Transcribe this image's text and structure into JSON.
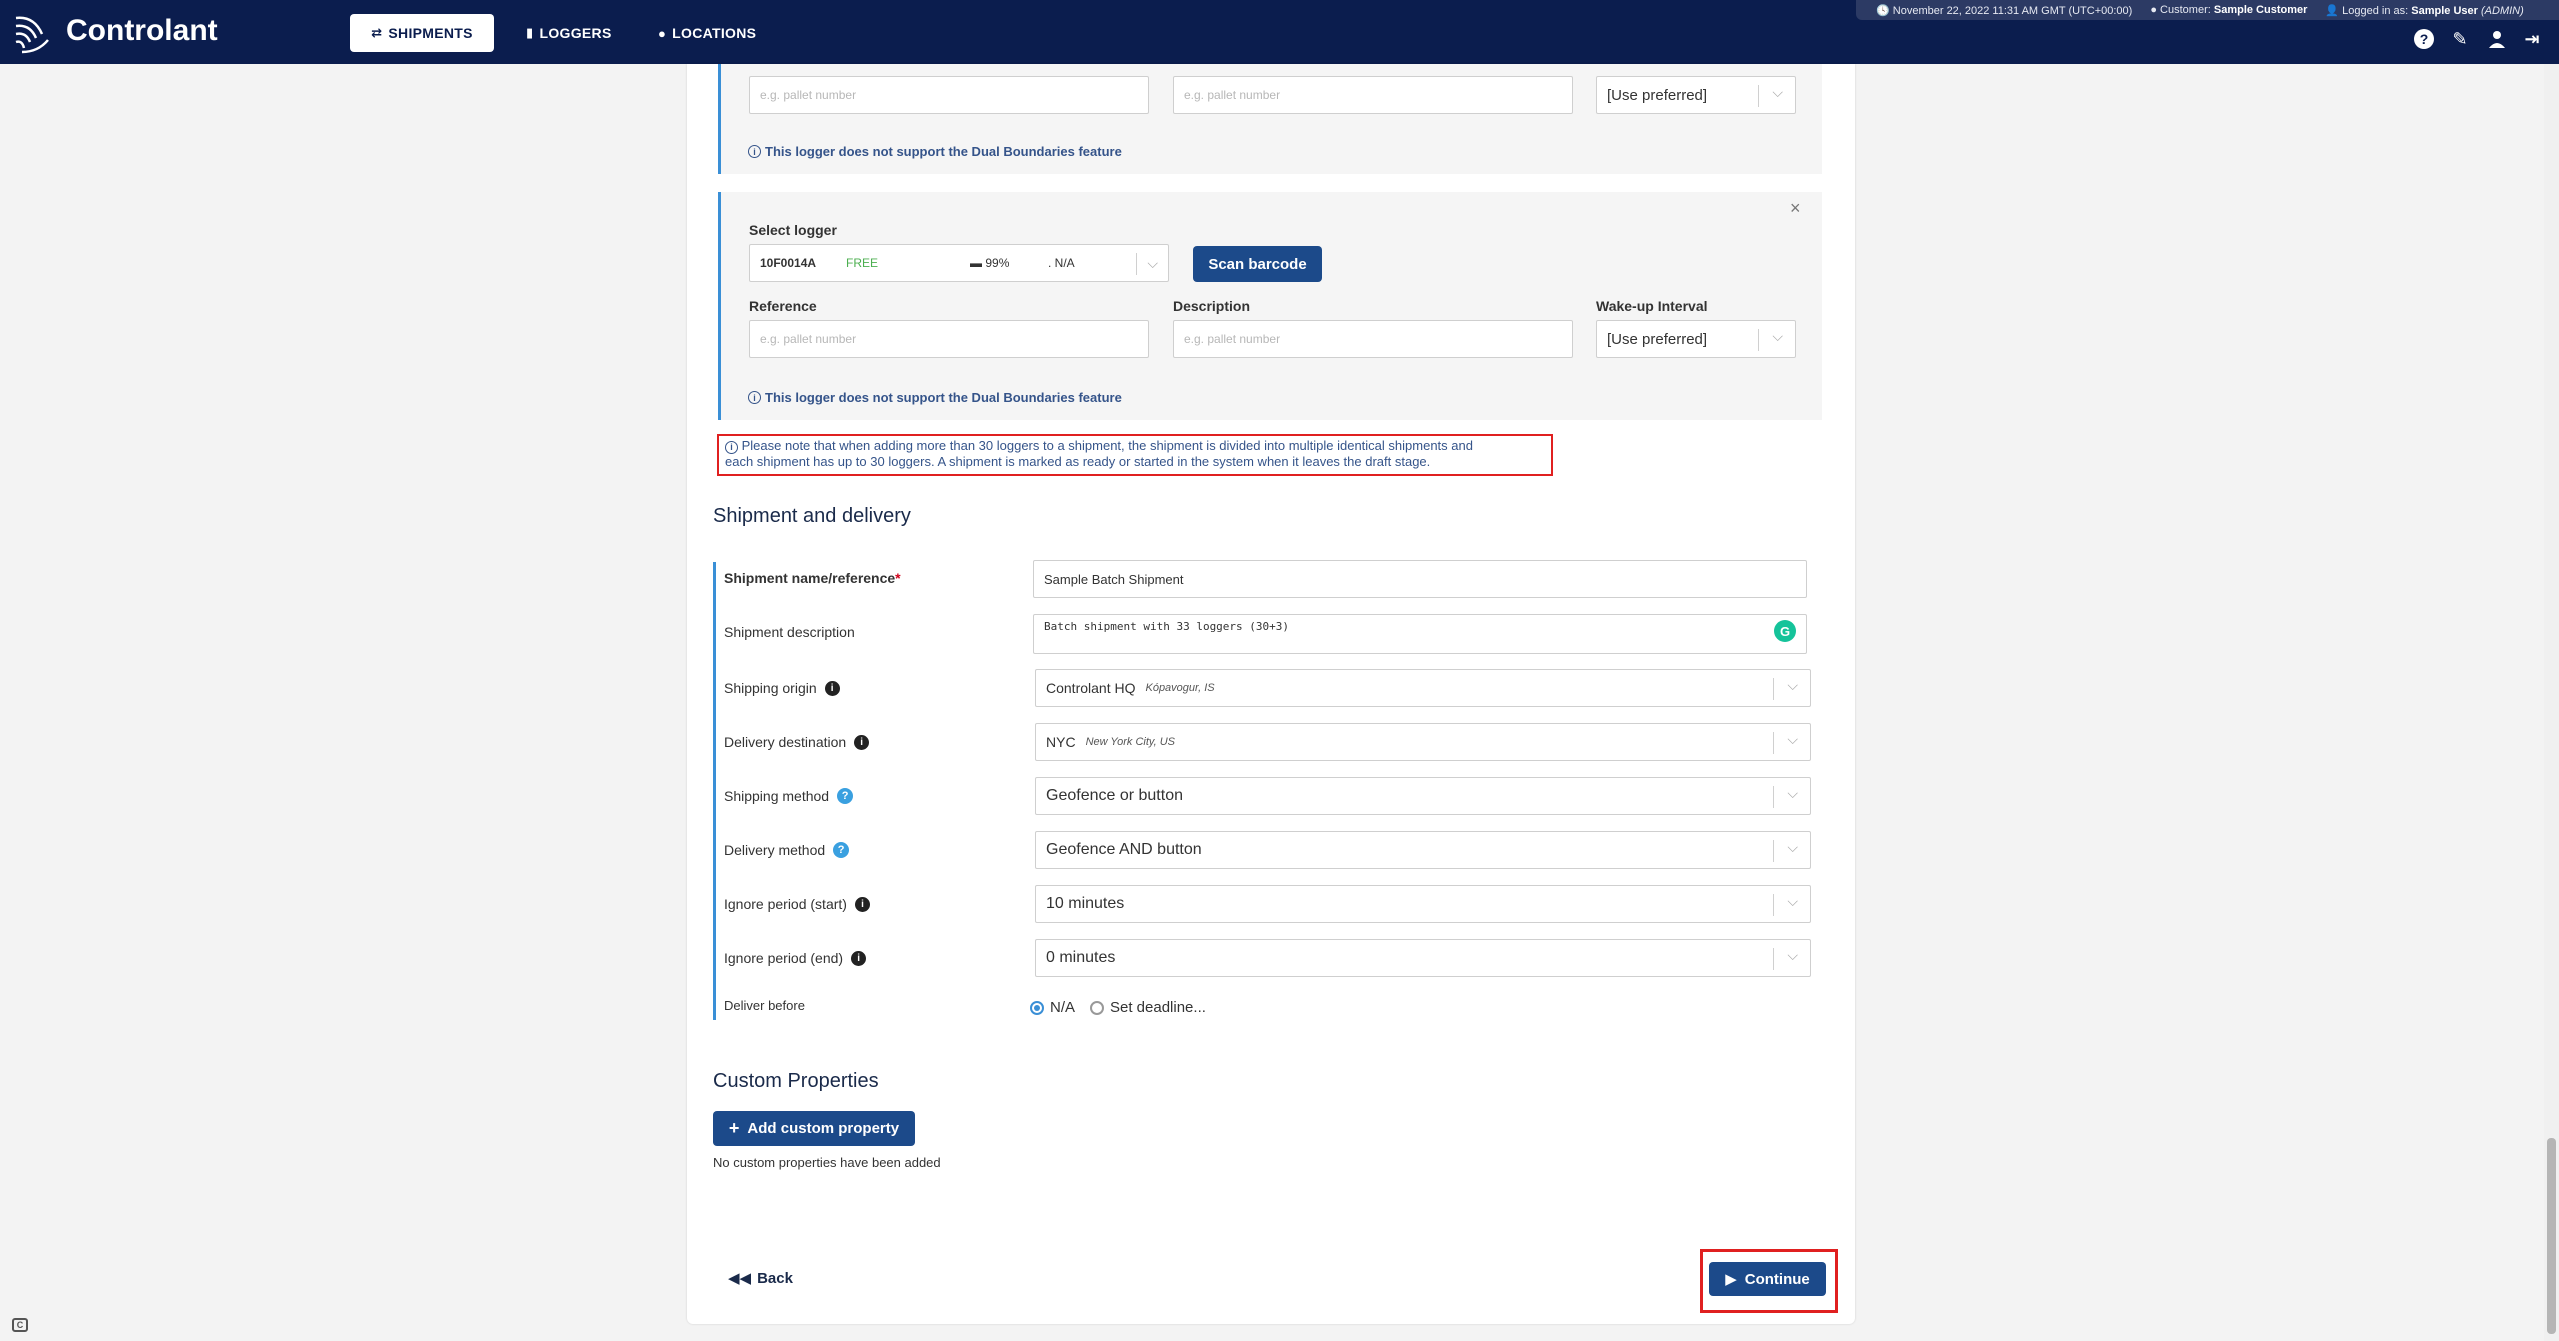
{
  "app": {
    "brand": "Controlant"
  },
  "nav": {
    "shipments": "SHIPMENTS",
    "loggers": "LOGGERS",
    "locations": "LOCATIONS"
  },
  "infobar": {
    "datetime": "November 22, 2022 11:31 AM GMT (UTC+00:00)",
    "customer_label": "Customer:",
    "customer_value": "Sample Customer",
    "logged_label": "Logged in as:",
    "logged_value": "Sample User",
    "role": "(ADMIN)"
  },
  "logger1": {
    "reference_placeholder": "e.g. pallet number",
    "description_placeholder": "e.g. pallet number",
    "wakeup_value": "[Use preferred]",
    "note": "This logger does not support the Dual Boundaries feature"
  },
  "logger2": {
    "select_logger_label": "Select logger",
    "logger_id": "10F0014A",
    "logger_status": "FREE",
    "logger_battery": "99%",
    "logger_signal": "N/A",
    "scan_barcode": "Scan barcode",
    "reference_label": "Reference",
    "description_label": "Description",
    "wakeup_label": "Wake-up Interval",
    "reference_placeholder": "e.g. pallet number",
    "description_placeholder": "e.g. pallet number",
    "wakeup_value": "[Use preferred]",
    "note": "This logger does not support the Dual Boundaries feature"
  },
  "warning": {
    "line1": "Please note that when adding more than 30 loggers to a shipment, the shipment is divided into multiple identical shipments and",
    "line2": "each shipment has up to 30 loggers. A shipment is marked as ready or started in the system when it leaves the draft stage."
  },
  "shipment": {
    "section_title": "Shipment and delivery",
    "name_label": "Shipment name/reference",
    "name_value": "Sample Batch Shipment",
    "description_label": "Shipment description",
    "description_value": "Batch shipment with 33 loggers (30+3)",
    "origin_label": "Shipping origin",
    "origin_value": "Controlant HQ",
    "origin_sub": "Kópavogur, IS",
    "destination_label": "Delivery destination",
    "destination_value": "NYC",
    "destination_sub": "New York City, US",
    "shipping_method_label": "Shipping method",
    "shipping_method_value": "Geofence or button",
    "delivery_method_label": "Delivery method",
    "delivery_method_value": "Geofence AND button",
    "ignore_start_label": "Ignore period (start)",
    "ignore_start_value": "10 minutes",
    "ignore_end_label": "Ignore period (end)",
    "ignore_end_value": "0 minutes",
    "deliver_before_label": "Deliver before",
    "deliver_before_options": [
      "N/A",
      "Set deadline..."
    ],
    "deliver_before_selected": "N/A"
  },
  "custom": {
    "section_title": "Custom Properties",
    "add_button": "Add custom property",
    "empty_text": "No custom properties have been added"
  },
  "footer": {
    "back": "Back",
    "continue": "Continue"
  },
  "colors": {
    "topbar": "#0b1d4e",
    "primary": "#1c4a8a",
    "accent": "#3a8fd6",
    "highlight": "#e02020",
    "free": "#4caf50"
  }
}
